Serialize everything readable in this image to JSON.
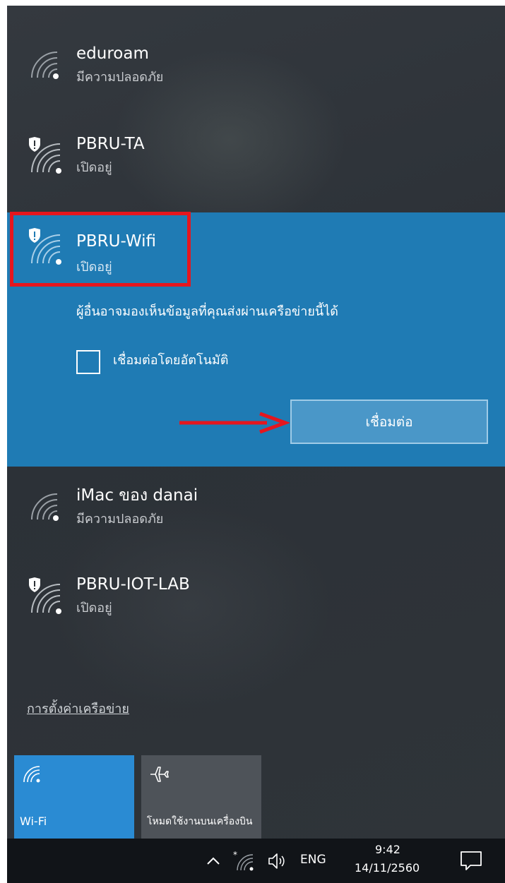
{
  "networks": [
    {
      "name": "eduroam",
      "status": "มีความปลอดภัย",
      "secured": true
    },
    {
      "name": "PBRU-TA",
      "status": "เปิดอยู่",
      "secured": false
    },
    {
      "name": "PBRU-Wifi",
      "status": "เปิดอยู่",
      "secured": false,
      "selected": true
    },
    {
      "name": "iMac ของ danai",
      "status": "มีความปลอดภัย",
      "secured": true
    },
    {
      "name": "PBRU-IOT-LAB",
      "status": "เปิดอยู่",
      "secured": false
    }
  ],
  "selected_panel": {
    "warning": "ผู้อื่นอาจมองเห็นข้อมูลที่คุณส่งผ่านเครือข่ายนี้ได้",
    "auto_connect_label": "เชื่อมต่อโดยอัตโนมัติ",
    "auto_connect_checked": false,
    "connect_label": "เชื่อมต่อ"
  },
  "settings_link": "การตั้งค่าเครือข่าย",
  "quick_actions": [
    {
      "label": "Wi-Fi",
      "active": true,
      "icon": "wifi-icon"
    },
    {
      "label": "โหมดใช้งานบนเครื่องบิน",
      "active": false,
      "icon": "airplane-icon"
    }
  ],
  "taskbar": {
    "language": "ENG",
    "time": "9:42",
    "date": "14/11/2560"
  },
  "colors": {
    "selected_bg": "#1f7bb4",
    "accent_tile": "#2a8bd3",
    "highlight": "#e5161e"
  }
}
